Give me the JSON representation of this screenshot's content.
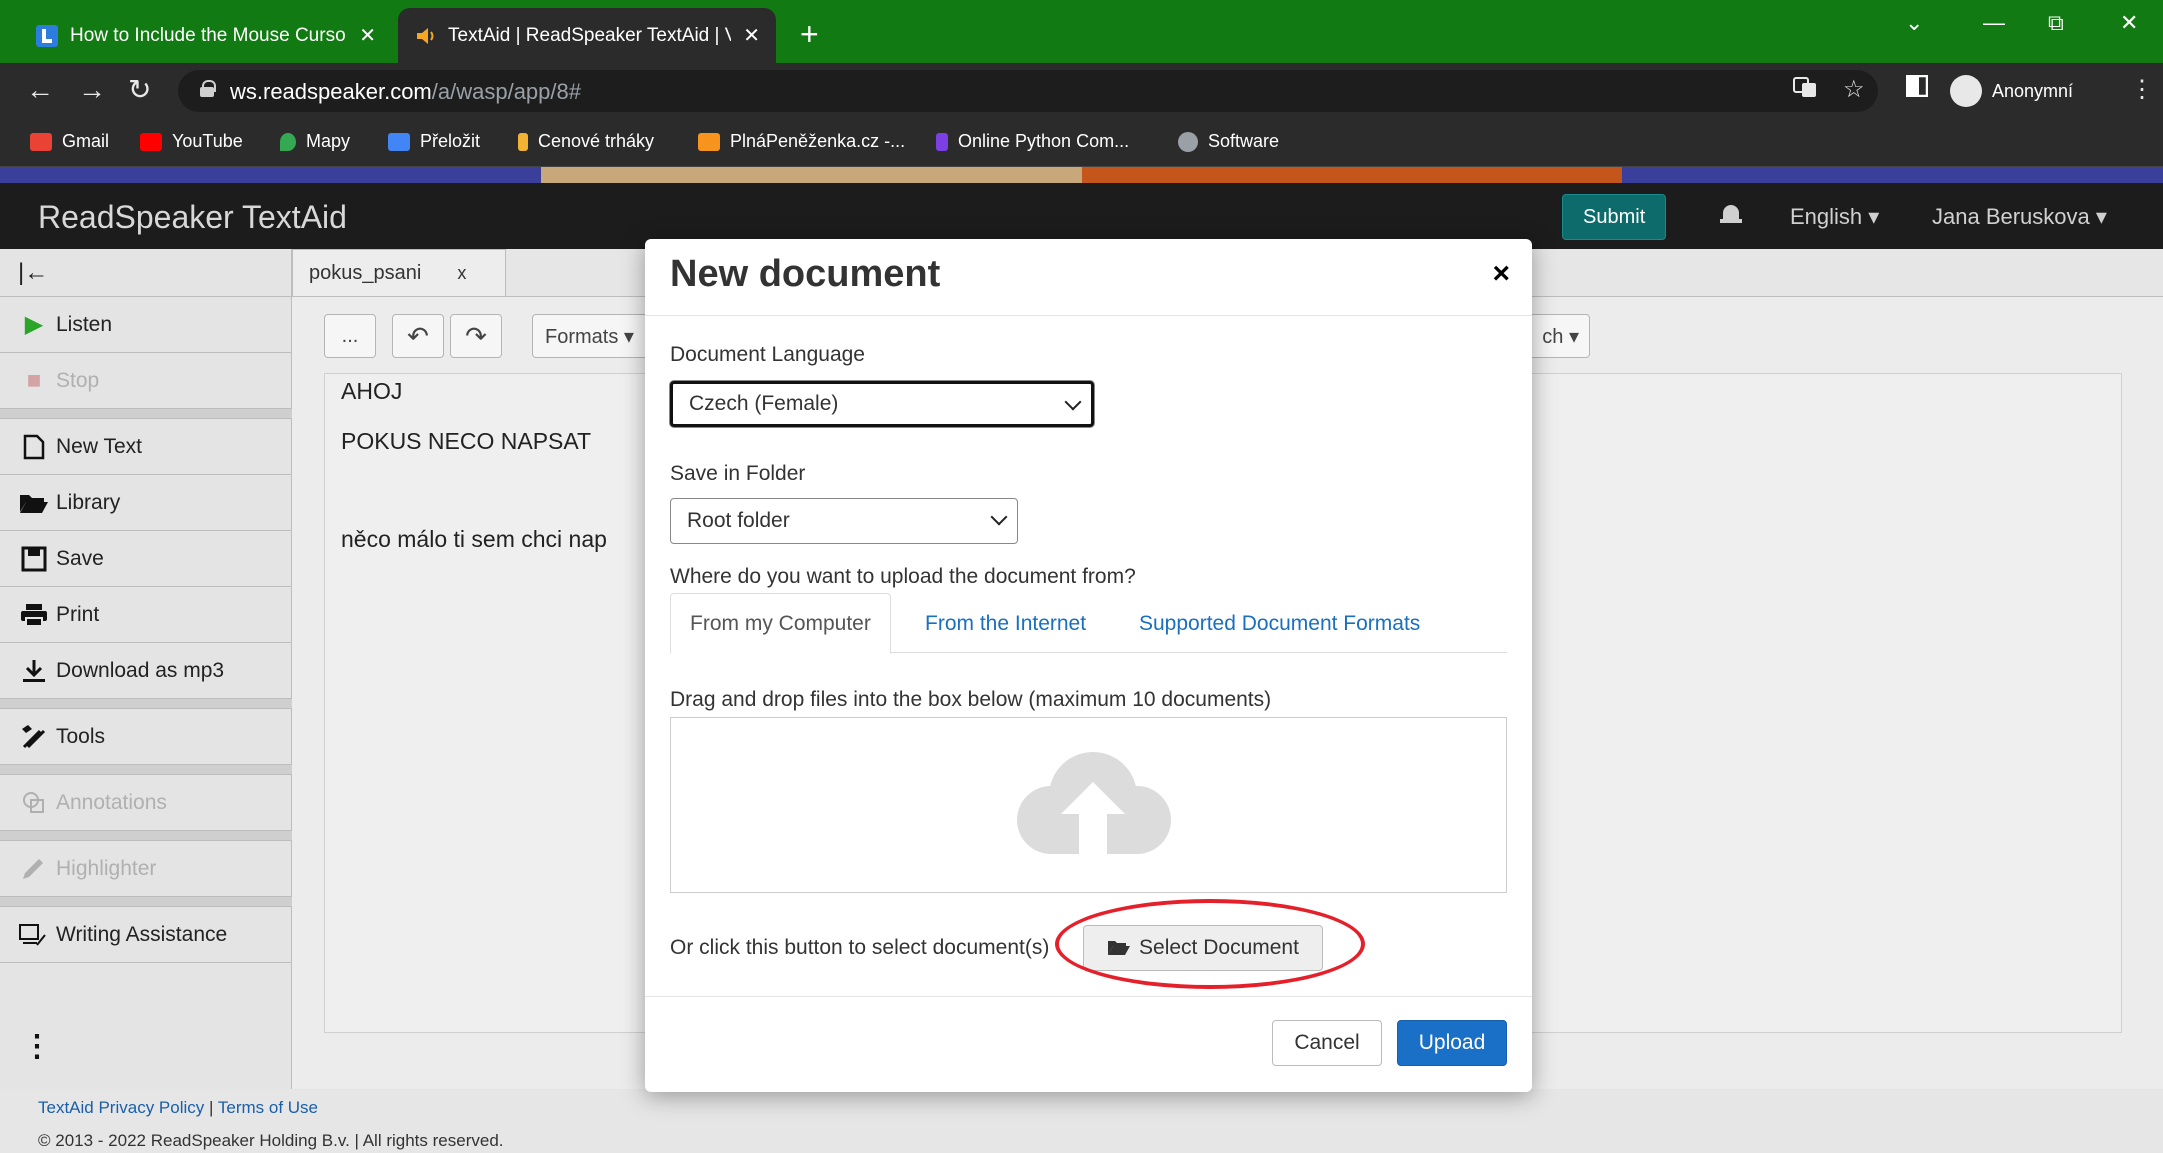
{
  "browser": {
    "tabs": [
      {
        "title": "How to Include the Mouse Curso",
        "close": "✕",
        "favicon_color": "#2d7de0"
      },
      {
        "title": "TextAid | ReadSpeaker TextAid | V",
        "close": "✕",
        "favicon_color": "#f5a623"
      }
    ],
    "new_tab": "+",
    "window_controls": {
      "minimize": "—",
      "restore": "⧉",
      "close": "✕",
      "tab_search": "⌄"
    },
    "nav": {
      "back": "←",
      "forward": "→",
      "reload": "↻"
    },
    "url_host": "ws.readspeaker.com",
    "url_path": "/a/wasp/app/8#",
    "profile_label": "Anonymní",
    "menu": "⋮",
    "bookmarks": [
      {
        "label": "Gmail",
        "color": "#ea4335"
      },
      {
        "label": "YouTube",
        "color": "#ff0000"
      },
      {
        "label": "Mapy",
        "color": "#34a853"
      },
      {
        "label": "Přeložit",
        "color": "#4285f4"
      },
      {
        "label": "Cenové trháky",
        "color": "#f2b233"
      },
      {
        "label": "PlnáPeněženka.cz -...",
        "color": "#f7941d"
      },
      {
        "label": "Online Python Com...",
        "color": "#7b3fe4"
      },
      {
        "label": "Software",
        "color": "#9aa0a6"
      }
    ]
  },
  "stripe_colors": [
    "#3b3f9c",
    "#c8a77a",
    "#c4561c",
    "#3b3f9c"
  ],
  "app": {
    "title": "ReadSpeaker TextAid",
    "submit": "Submit",
    "language": "English ▾",
    "user": "Jana Beruskova ▾"
  },
  "sidebar": {
    "collapse": "|←",
    "items": {
      "listen": "Listen",
      "stop": "Stop",
      "new_text": "New Text",
      "library": "Library",
      "save": "Save",
      "print": "Print",
      "download": "Download as mp3",
      "tools": "Tools",
      "annotations": "Annotations",
      "highlighter": "Highlighter",
      "writing": "Writing Assistance"
    },
    "more": "⋮"
  },
  "editor": {
    "doc_tab": "pokus_psani",
    "doc_tab_close": "x",
    "toolbar": {
      "more": "...",
      "undo": "↶",
      "redo": "↷",
      "formats": "Formats ▾",
      "right_dropdown": "ch ▾"
    },
    "lines": [
      "AHOJ",
      "POKUS NECO NAPSAT",
      "něco málo ti sem chci nap"
    ]
  },
  "footer": {
    "privacy": "TextAid Privacy Policy",
    "separator": "|",
    "terms": "Terms of Use",
    "copyright": "© 2013 - 2022 ReadSpeaker Holding B.v. | All rights reserved."
  },
  "modal": {
    "title": "New document",
    "close": "×",
    "language_label": "Document Language",
    "language_value": "Czech (Female)",
    "folder_label": "Save in Folder",
    "folder_value": "Root folder",
    "source_label": "Where do you want to upload the document from?",
    "tabs": [
      "From my Computer",
      "From the Internet",
      "Supported Document Formats"
    ],
    "drag_label": "Drag and drop files into the box below (maximum 10 documents)",
    "select_prompt": "Or click this button to select document(s)",
    "select_button": "Select Document",
    "cancel": "Cancel",
    "upload": "Upload"
  }
}
